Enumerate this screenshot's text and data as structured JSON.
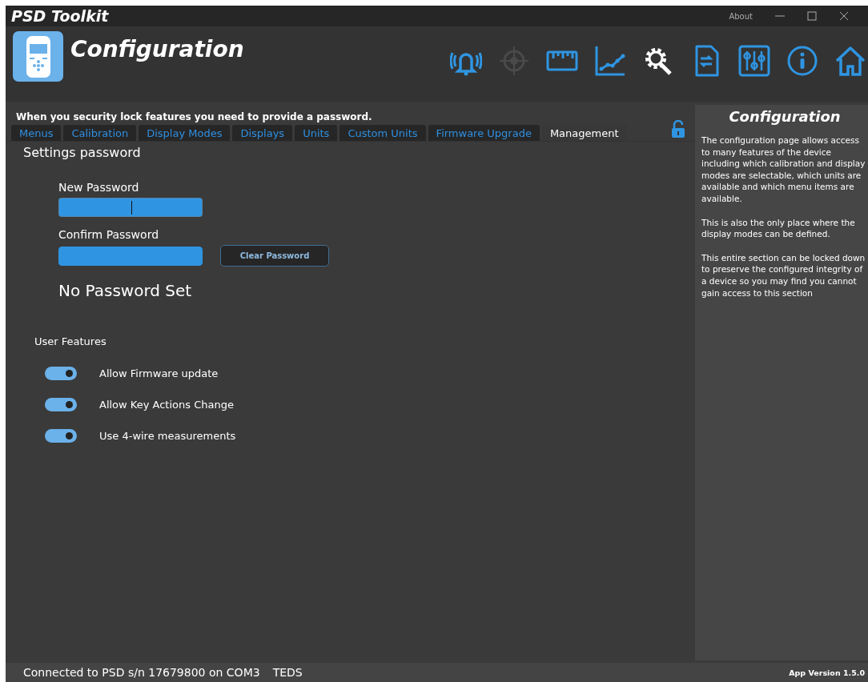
{
  "window": {
    "title": "PSD Toolkit",
    "about": "About"
  },
  "header": {
    "title": "Configuration"
  },
  "toolbar": [
    {
      "selected": false,
      "disabled": false
    },
    {
      "selected": false,
      "disabled": true
    },
    {
      "selected": false,
      "disabled": false
    },
    {
      "selected": false,
      "disabled": false
    },
    {
      "selected": true,
      "disabled": false
    },
    {
      "selected": false,
      "disabled": false
    },
    {
      "selected": false,
      "disabled": false
    },
    {
      "selected": false,
      "disabled": false
    },
    {
      "selected": false,
      "disabled": false
    }
  ],
  "notice": "When you security lock features you need to provide a password.",
  "locked": false,
  "tabs": [
    {
      "label": "Menus",
      "selected": false
    },
    {
      "label": "Calibration",
      "selected": false
    },
    {
      "label": "Display Modes",
      "selected": false
    },
    {
      "label": "Displays",
      "selected": false
    },
    {
      "label": "Units",
      "selected": false
    },
    {
      "label": "Custom Units",
      "selected": false
    },
    {
      "label": "Firmware Upgrade",
      "selected": false
    },
    {
      "label": "Management",
      "selected": true
    }
  ],
  "section_title": "Settings password",
  "new_password": {
    "label": "New Password",
    "focused": true
  },
  "confirm_password": {
    "label": "Confirm Password",
    "focused": false
  },
  "clear_button": "Clear Password",
  "password_status": "No Password Set",
  "features_title": "User Features",
  "features": [
    {
      "label": "Allow Firmware update",
      "on": true
    },
    {
      "label": "Allow Key Actions Change",
      "on": true
    },
    {
      "label": "Use 4-wire measurements",
      "on": true
    }
  ],
  "help": {
    "title": "Configuration",
    "paragraphs": [
      "The configuration page allows access to many features of the device including which calibration and display modes are selectable, which units are available and which menu items are available.",
      "This is also the only place where the display modes can be defined.",
      "This entire section can be locked down to preserve the configured integrity of a device so you may find you cannot gain access to this section"
    ]
  },
  "status_bar": {
    "connection": "Connected to PSD s/n 17679800 on COM3",
    "teds": "TEDS",
    "version": "App Version 1.5.0"
  }
}
